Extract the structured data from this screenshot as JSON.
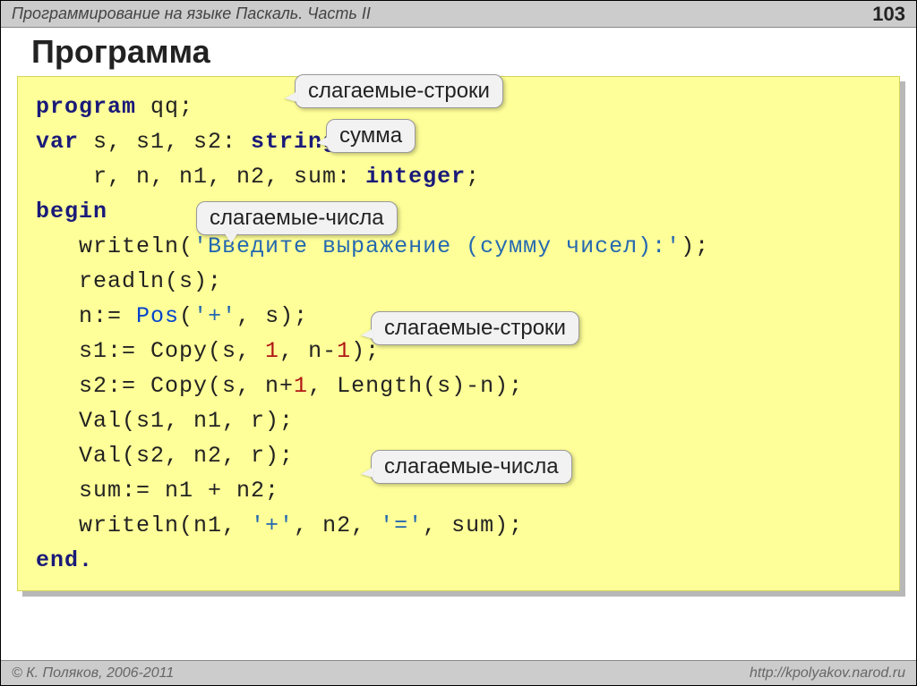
{
  "header": {
    "title": "Программирование на языке Паскаль. Часть II",
    "page": "103"
  },
  "title": "Программа",
  "code": {
    "l1a": "program",
    "l1b": " qq;",
    "l2a": "var",
    "l2b": " s, s1, s2: ",
    "l2c": "string",
    "l2d": ";",
    "l3a": "    r, n, n1, n2, sum: ",
    "l3b": "integer",
    "l3c": ";",
    "l4": "begin",
    "l5a": "   writeln(",
    "l5b": "'Введите выражение (сумму чисел):'",
    "l5c": ");",
    "l6": "   readln(s);",
    "l7a": "   n:= ",
    "l7b": "Pos",
    "l7c": "(",
    "l7d": "'+'",
    "l7e": ", s);",
    "l8a": "   s1:= Copy(s, ",
    "l8b": "1",
    "l8c": ", n-",
    "l8d": "1",
    "l8e": ");",
    "l9a": "   s2:= Copy(s, n+",
    "l9b": "1",
    "l9c": ", Length(s)-n);",
    "l10": "   Val(s1, n1, r);",
    "l11": "   Val(s2, n2, r);",
    "l12": "   sum:= n1 + n2;",
    "l13a": "   writeln(n1, ",
    "l13b": "'+'",
    "l13c": ", n2, ",
    "l13d": "'='",
    "l13e": ", sum);",
    "l14": "end."
  },
  "callouts": {
    "c1": "слагаемые-строки",
    "c2": "сумма",
    "c3": "слагаемые-числа",
    "c4": "слагаемые-строки",
    "c5": "слагаемые-числа"
  },
  "footer": {
    "left": "© К. Поляков, 2006-2011",
    "right": "http://kpolyakov.narod.ru"
  }
}
